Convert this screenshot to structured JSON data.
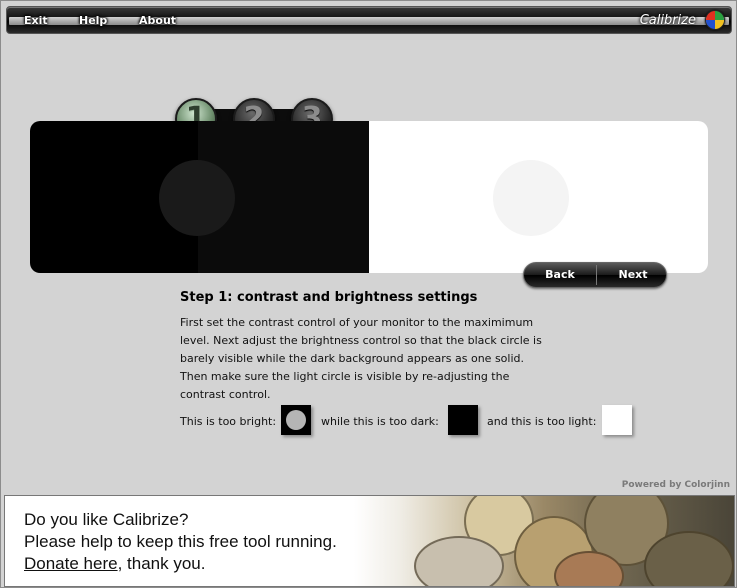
{
  "menu": {
    "exit": "Exit",
    "help": "Help",
    "about": "About",
    "brand": "Calibrize"
  },
  "steps": [
    "1",
    "2",
    "3"
  ],
  "active_step": 1,
  "nav": {
    "back": "Back",
    "next": "Next"
  },
  "instructions": {
    "title": "Step 1: contrast and brightness settings",
    "lines": [
      "First set the contrast control of your monitor to the maximimum",
      "level. Next adjust the brightness control so that the black circle is",
      "barely visible while the dark background appears as one solid.",
      "Then make sure the light circle is visible by re-adjusting the",
      "contrast control."
    ],
    "too_bright": "This is too bright:",
    "too_dark": "while this is too dark:",
    "too_light": "and this is too light:"
  },
  "powered_by": "Powered by Colorjinn",
  "banner": {
    "line1": "Do you like Calibrize?",
    "line2": "Please help to keep this free tool running.",
    "donate": "Donate here",
    "thanks": ", thank you."
  },
  "colors": {
    "logo_quadrants": [
      "#e03020",
      "#2aa040",
      "#2050d0",
      "#f0c020"
    ]
  }
}
